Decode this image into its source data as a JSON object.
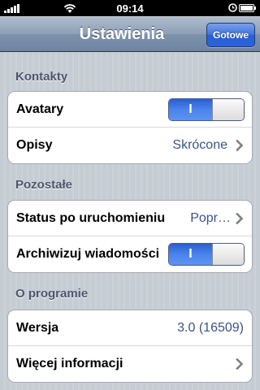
{
  "status_bar": {
    "time": "09:14",
    "icons": [
      "signal-icon",
      "wifi-icon",
      "alarm-icon",
      "battery-icon"
    ]
  },
  "nav": {
    "title": "Ustawienia",
    "done_label": "Gotowe"
  },
  "colors": {
    "value_text": "#385487",
    "section_header": "#4c566c",
    "toggle_on": "#3d72de"
  },
  "sections": [
    {
      "header": "Kontakty",
      "rows": [
        {
          "label": "Avatary",
          "control": "toggle",
          "toggle_text": "I",
          "on": true
        },
        {
          "label": "Opisy",
          "value": "Skrócone",
          "control": "disclosure"
        }
      ]
    },
    {
      "header": "Pozostałe",
      "rows": [
        {
          "label": "Status po uruchomieniu",
          "value": "Popr…",
          "control": "disclosure"
        },
        {
          "label": "Archiwizuj wiadomości",
          "control": "toggle",
          "toggle_text": "I",
          "on": true
        }
      ]
    },
    {
      "header": "O programie",
      "rows": [
        {
          "label": "Wersja",
          "value": "3.0 (16509)",
          "control": "none"
        },
        {
          "label": "Więcej informacji",
          "control": "disclosure"
        }
      ]
    }
  ]
}
